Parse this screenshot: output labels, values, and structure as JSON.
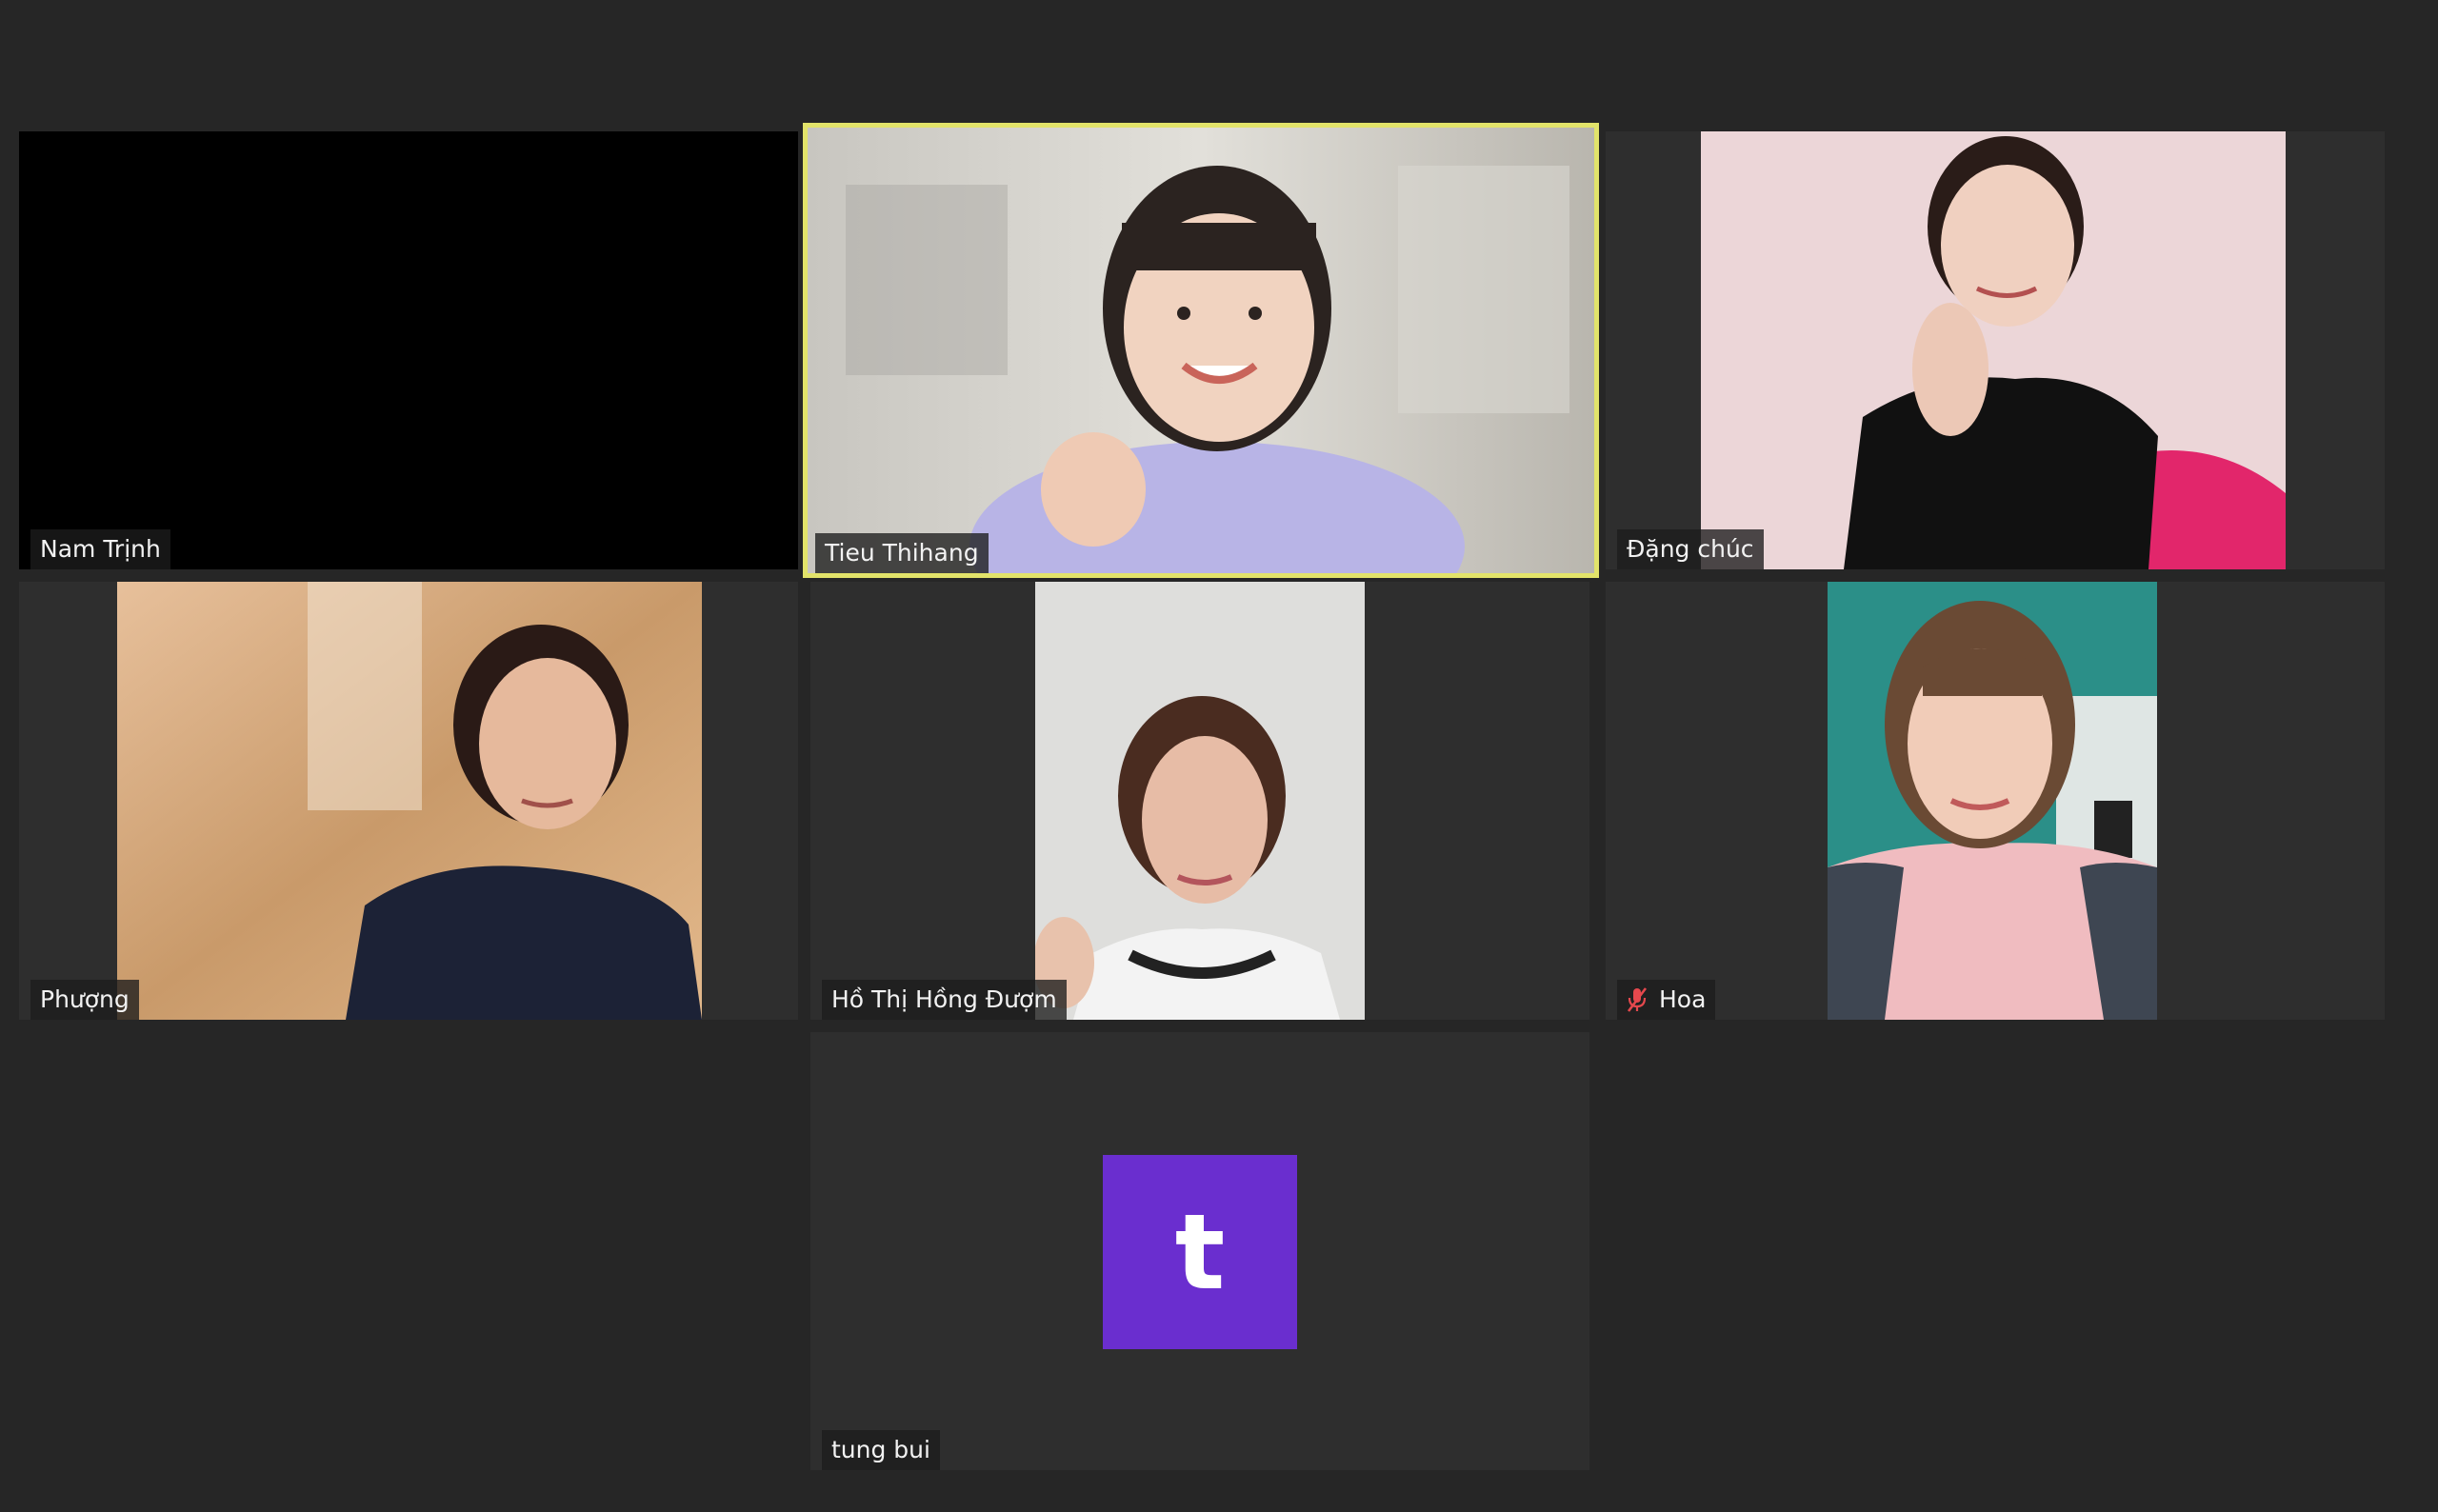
{
  "participants": [
    {
      "name": "Nam Trịnh",
      "video": false
    },
    {
      "name": "Tieu Thihang",
      "video": true,
      "active_speaker": true
    },
    {
      "name": "Đặng chúc",
      "video": true
    },
    {
      "name": "Phượng",
      "video": true
    },
    {
      "name": "Hồ Thị Hồng Đượm",
      "video": true
    },
    {
      "name": "Hoa",
      "video": true,
      "muted": true,
      "mute_icon": "microphone-muted-icon"
    },
    {
      "name": "tung bui",
      "video": false,
      "avatar_letter": "t",
      "avatar_color": "#6a2ecf"
    }
  ],
  "colors": {
    "background": "#262626",
    "tile": "#2e2e2e",
    "active_speaker_border": "#e2e36a",
    "mute_icon": "#e5484d"
  }
}
